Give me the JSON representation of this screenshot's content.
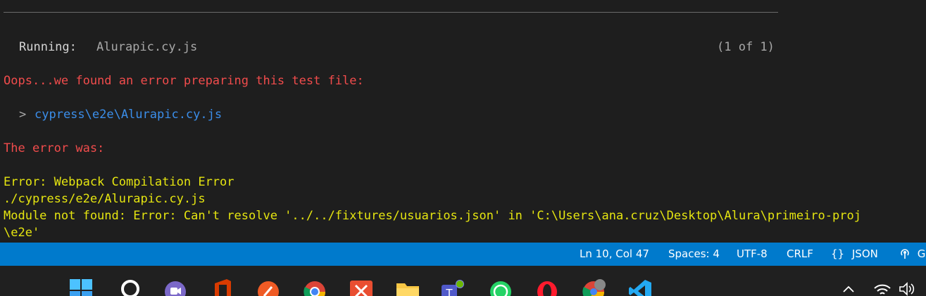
{
  "terminal": {
    "running_label": "Running:",
    "running_file": "Alurapic.cy.js",
    "running_count": "(1 of 1)",
    "error_heading": "Oops...we found an error preparing this test file:",
    "chevron": ">",
    "file_path": "cypress\\e2e\\Alurapic.cy.js",
    "error_was": "The error was:",
    "error_lines": [
      "Error: Webpack Compilation Error",
      "./cypress/e2e/Alurapic.cy.js",
      "Module not found: Error: Can't resolve '../../fixtures/usuarios.json' in 'C:\\Users\\ana.cruz\\Desktop\\Alura\\primeiro-proj",
      "\\e2e'"
    ]
  },
  "statusbar": {
    "position": "Ln 10, Col 47",
    "spaces": "Spaces: 4",
    "encoding": "UTF-8",
    "eol": "CRLF",
    "language_braces": "{}",
    "language": "JSON",
    "extra": "Go"
  },
  "taskbar": {
    "icons": [
      "windows-start-icon",
      "search-icon",
      "clipchamp-icon",
      "office-icon",
      "postman-icon",
      "chrome-icon",
      "git-icon",
      "file-explorer-icon",
      "teams-icon",
      "whatsapp-icon",
      "opera-icon",
      "chrome-profile-icon",
      "vscode-icon"
    ],
    "tray_icons": [
      "chevron-up-icon",
      "wifi-icon",
      "volume-icon"
    ]
  }
}
